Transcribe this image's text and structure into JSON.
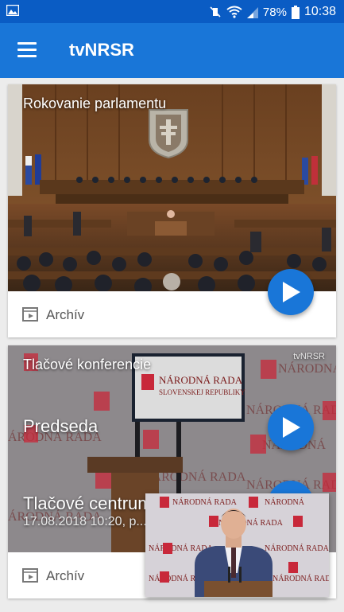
{
  "statusbar": {
    "battery_percent": "78%",
    "time": "10:38"
  },
  "appbar": {
    "title": "tvNRSR"
  },
  "cards": [
    {
      "title": "Rokovanie parlamentu",
      "footer_label": "Archív"
    },
    {
      "title": "Tlačové konferencie",
      "items": [
        {
          "title": "Predseda"
        },
        {
          "title": "Tlačové centrum",
          "date": "17.08.2018 10:20, p..."
        }
      ],
      "backdrop_text_1": "NÁRODNÁ RADA",
      "backdrop_text_2": "SLOVENSKEJ REPUBLIKY",
      "watermark": "tvNRSR",
      "footer_label": "Archív"
    }
  ],
  "colors": {
    "primary": "#1976d8",
    "statusbar": "#0a5cc4",
    "background": "#ececec"
  }
}
